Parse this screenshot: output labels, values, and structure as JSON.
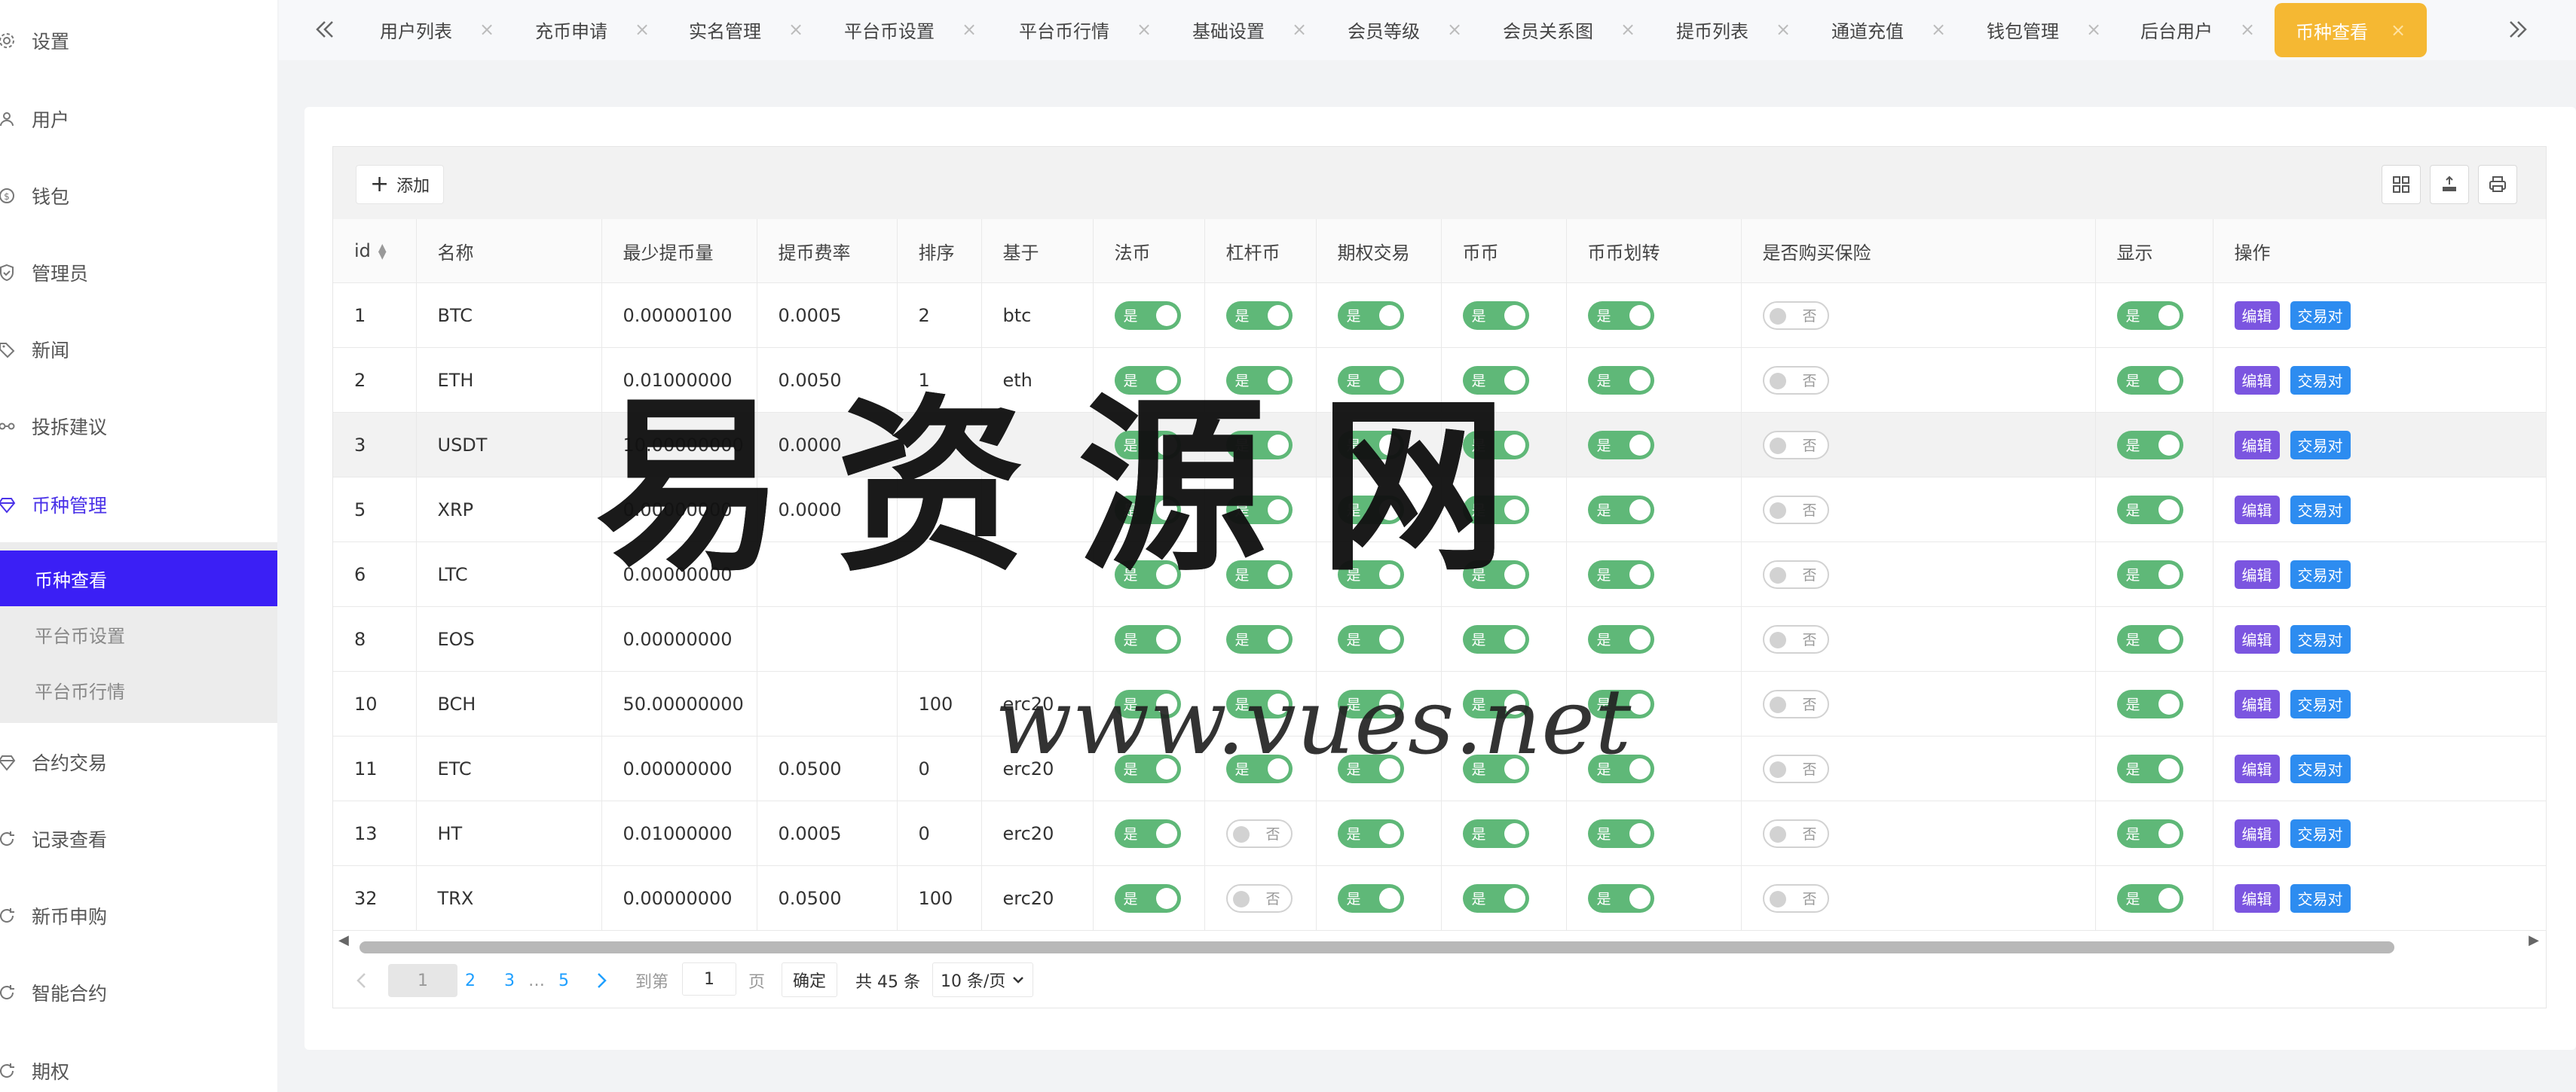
{
  "sidebar": {
    "items": [
      {
        "label": "设置",
        "icon": "gear-icon"
      },
      {
        "label": "用户",
        "icon": "user-icon"
      },
      {
        "label": "钱包",
        "icon": "wallet-icon"
      },
      {
        "label": "管理员",
        "icon": "shield-icon"
      },
      {
        "label": "新闻",
        "icon": "tag-icon"
      },
      {
        "label": "投拆建议",
        "icon": "link-icon"
      },
      {
        "label": "币种管理",
        "icon": "diamond-icon"
      }
    ],
    "submenu": [
      {
        "label": "币种查看"
      },
      {
        "label": "平台币设置"
      },
      {
        "label": "平台币行情"
      }
    ],
    "items_after": [
      {
        "label": "合约交易",
        "icon": "diamond-icon"
      },
      {
        "label": "记录查看",
        "icon": "refresh-icon"
      },
      {
        "label": "新币申购",
        "icon": "refresh-icon"
      },
      {
        "label": "智能合约",
        "icon": "refresh-icon"
      },
      {
        "label": "期权",
        "icon": "refresh-icon"
      }
    ]
  },
  "tabs": [
    {
      "label": "用户列表"
    },
    {
      "label": "充币申请"
    },
    {
      "label": "实名管理"
    },
    {
      "label": "平台币设置"
    },
    {
      "label": "平台币行情"
    },
    {
      "label": "基础设置"
    },
    {
      "label": "会员等级"
    },
    {
      "label": "会员关系图"
    },
    {
      "label": "提币列表"
    },
    {
      "label": "通道充值"
    },
    {
      "label": "钱包管理"
    },
    {
      "label": "后台用户"
    },
    {
      "label": "币种查看"
    }
  ],
  "tab_close": "×",
  "toolbar": {
    "add_label": "添加"
  },
  "table": {
    "headers": [
      "id",
      "名称",
      "最少提币量",
      "提币费率",
      "排序",
      "基于",
      "法币",
      "杠杆币",
      "期权交易",
      "币币",
      "币币划转",
      "是否购买保险",
      "显示",
      "操作"
    ],
    "switch_on": "是",
    "switch_off": "否",
    "edit_label": "编辑",
    "pair_label": "交易对",
    "rows": [
      {
        "id": "1",
        "name": "BTC",
        "min": "0.00000100",
        "rate": "0.0005",
        "sort": "2",
        "base": "btc",
        "lever": true
      },
      {
        "id": "2",
        "name": "ETH",
        "min": "0.01000000",
        "rate": "0.0050",
        "sort": "1",
        "base": "eth",
        "lever": true
      },
      {
        "id": "3",
        "name": "USDT",
        "min": "10.00000000",
        "rate": "0.0000",
        "sort": "",
        "base": "",
        "lever": true
      },
      {
        "id": "5",
        "name": "XRP",
        "min": "0.00000000",
        "rate": "0.0000",
        "sort": "",
        "base": "",
        "lever": true
      },
      {
        "id": "6",
        "name": "LTC",
        "min": "0.00000000",
        "rate": "",
        "sort": "",
        "base": "",
        "lever": true
      },
      {
        "id": "8",
        "name": "EOS",
        "min": "0.00000000",
        "rate": "",
        "sort": "",
        "base": "",
        "lever": true
      },
      {
        "id": "10",
        "name": "BCH",
        "min": "50.00000000",
        "rate": "",
        "sort": "100",
        "base": "erc20",
        "lever": true
      },
      {
        "id": "11",
        "name": "ETC",
        "min": "0.00000000",
        "rate": "0.0500",
        "sort": "0",
        "base": "erc20",
        "lever": true
      },
      {
        "id": "13",
        "name": "HT",
        "min": "0.01000000",
        "rate": "0.0005",
        "sort": "0",
        "base": "erc20",
        "lever": false
      },
      {
        "id": "32",
        "name": "TRX",
        "min": "0.00000000",
        "rate": "0.0500",
        "sort": "100",
        "base": "erc20",
        "lever": false
      }
    ]
  },
  "pagination": {
    "pages": [
      "1",
      "2",
      "3",
      "…",
      "5"
    ],
    "goto_label": "到第",
    "goto_value": "1",
    "page_unit": "页",
    "confirm_label": "确定",
    "total_label": "共 45 条",
    "page_size": "10 条/页"
  },
  "watermark": {
    "title": "易资源网",
    "url": "www.vues.net"
  },
  "colors": {
    "accent": "#3b1ff5",
    "active_tab": "#f5b833",
    "switch_on": "#5fb878",
    "edit": "#7b55e0",
    "pair": "#2d8cf0"
  }
}
